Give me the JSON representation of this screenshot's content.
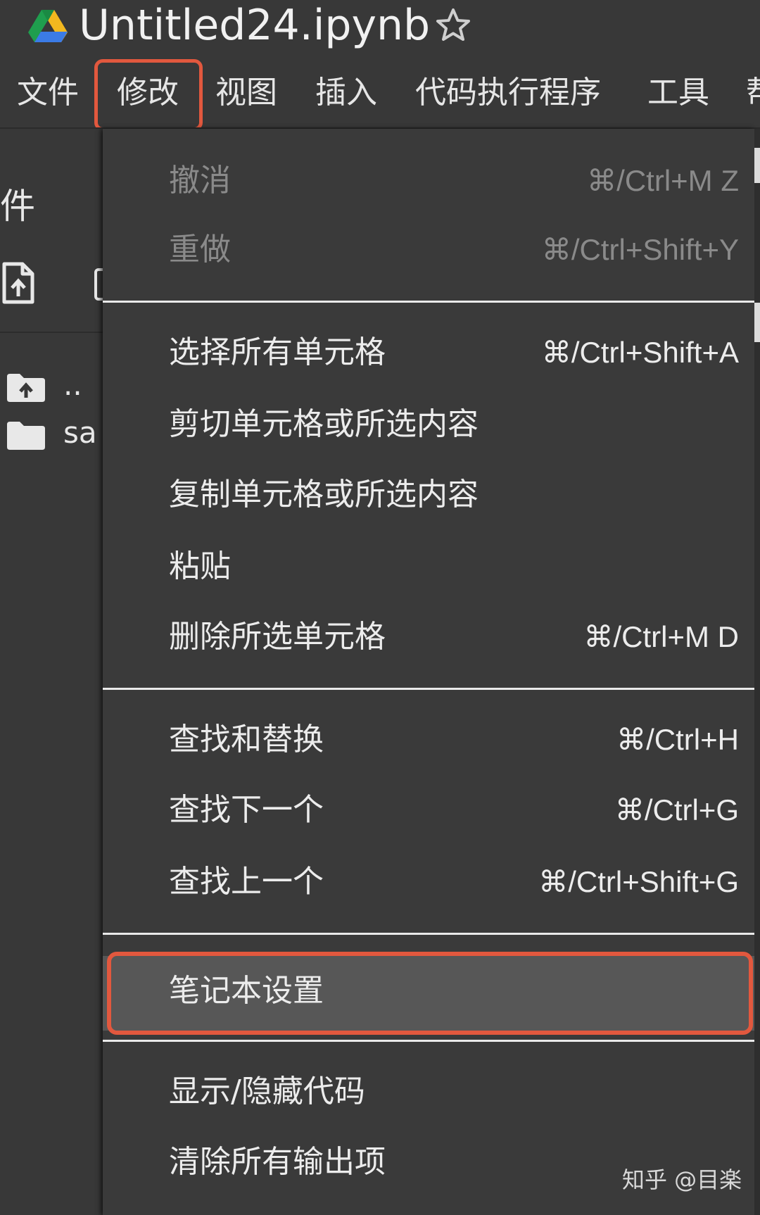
{
  "title": {
    "doc_name": "Untitled24.ipynb"
  },
  "menubar": {
    "items": [
      {
        "label": "文件"
      },
      {
        "label": "修改"
      },
      {
        "label": "视图"
      },
      {
        "label": "插入"
      },
      {
        "label": "代码执行程序"
      },
      {
        "label": "工具"
      },
      {
        "label": "帮"
      }
    ],
    "active": "修改"
  },
  "sidebar": {
    "title": "件",
    "files": [
      {
        "name": "..",
        "icon": "upload-folder-icon"
      },
      {
        "name": "sa",
        "icon": "folder-icon"
      }
    ]
  },
  "dropdown": {
    "groups": [
      [
        {
          "label": "撤消",
          "shortcut": "⌘/Ctrl+M Z",
          "disabled": true
        },
        {
          "label": "重做",
          "shortcut": "⌘/Ctrl+Shift+Y",
          "disabled": true
        }
      ],
      [
        {
          "label": "选择所有单元格",
          "shortcut": "⌘/Ctrl+Shift+A"
        },
        {
          "label": "剪切单元格或所选内容",
          "shortcut": ""
        },
        {
          "label": "复制单元格或所选内容",
          "shortcut": ""
        },
        {
          "label": "粘贴",
          "shortcut": ""
        },
        {
          "label": "删除所选单元格",
          "shortcut": "⌘/Ctrl+M D"
        }
      ],
      [
        {
          "label": "查找和替换",
          "shortcut": "⌘/Ctrl+H"
        },
        {
          "label": "查找下一个",
          "shortcut": "⌘/Ctrl+G"
        },
        {
          "label": "查找上一个",
          "shortcut": "⌘/Ctrl+Shift+G"
        }
      ],
      [
        {
          "label": "笔记本设置",
          "shortcut": "",
          "highlighted": true
        }
      ],
      [
        {
          "label": "显示/隐藏代码",
          "shortcut": ""
        },
        {
          "label": "清除所有输出项",
          "shortcut": ""
        }
      ]
    ]
  },
  "watermark": "知乎 @目楽",
  "colors": {
    "background": "#383838",
    "menu_background": "#3a3a3a",
    "highlight_border": "#e2583e",
    "highlighted_item": "#575757",
    "disabled_text": "#8a8a8a"
  }
}
